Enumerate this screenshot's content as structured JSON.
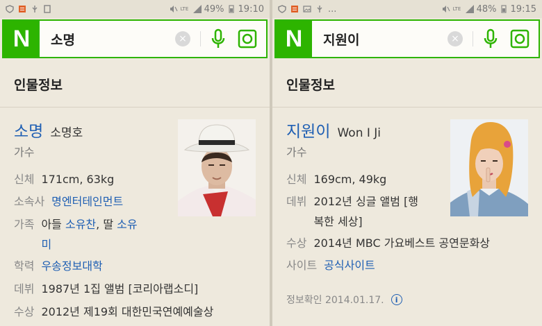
{
  "left": {
    "status": {
      "battery": "49%",
      "time": "19:10",
      "lte": "LTE"
    },
    "search": {
      "logo": "N",
      "query": "소명",
      "clear": "×"
    },
    "section_title": "인물정보",
    "person": {
      "name": "소명",
      "alt_name": "소명호",
      "job": "가수",
      "height_weight": {
        "label": "신체",
        "value": "171cm, 63kg"
      },
      "agency": {
        "label": "소속사",
        "value": "명엔터테인먼트"
      },
      "family": {
        "label": "가족",
        "prefix": "아들 ",
        "son": "소유찬",
        "mid": ", 딸 ",
        "daughter_l1": "소유",
        "daughter_l2": "미"
      },
      "education": {
        "label": "학력",
        "value": "우송정보대학"
      },
      "debut": {
        "label": "데뷔",
        "value": "1987년 1집 앨범 [코리아랩소디]"
      },
      "award": {
        "label": "수상",
        "value": "2012년 제19회 대한민국연예예술상"
      }
    }
  },
  "right": {
    "status": {
      "battery": "48%",
      "time": "19:15",
      "lte": "LTE",
      "more": "..."
    },
    "search": {
      "logo": "N",
      "query": "지원이",
      "clear": "×"
    },
    "section_title": "인물정보",
    "person": {
      "name": "지원이",
      "alt_name": "Won I Ji",
      "job": "가수",
      "height_weight": {
        "label": "신체",
        "value": "169cm, 49kg"
      },
      "debut": {
        "label": "데뷔",
        "value_l1": "2012년 싱글 앨범 [행",
        "value_l2": "복한 세상]"
      },
      "award": {
        "label": "수상",
        "value": "2014년 MBC 가요베스트 공연문화상"
      },
      "site": {
        "label": "사이트",
        "value": "공식사이트"
      },
      "verified": "정보확인 2014.01.17."
    }
  },
  "colors": {
    "brand_green": "#2db400",
    "link_blue": "#1f5fb3"
  }
}
